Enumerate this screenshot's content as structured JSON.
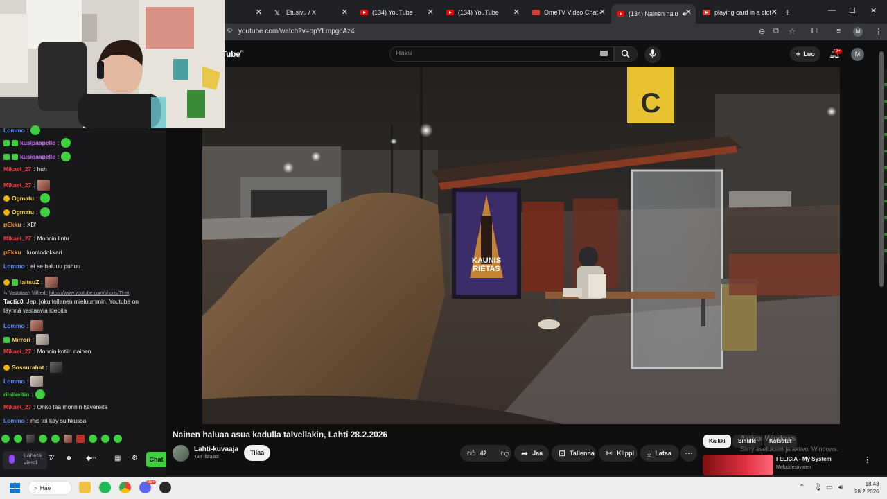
{
  "browser": {
    "tabs": [
      {
        "label": "",
        "icon": "blank"
      },
      {
        "label": "Etusivu / X",
        "icon": "x-logo-icon"
      },
      {
        "label": "(134) YouTube",
        "icon": "youtube-icon"
      },
      {
        "label": "(134) YouTube",
        "icon": "youtube-icon"
      },
      {
        "label": "OmeTV Video Chat -",
        "icon": "ometv-icon"
      },
      {
        "label": "(134) Nainen halu",
        "icon": "youtube-icon",
        "active": true,
        "audio": true
      },
      {
        "label": "playing card in a clot",
        "icon": "card-icon"
      }
    ],
    "url": "youtube.com/watch?v=bpYLmpgcAz4",
    "profile_initial": "M"
  },
  "youtube": {
    "logo_text": "Tube",
    "logo_sup": "FI",
    "search_placeholder": "Haku",
    "create_label": "Luo",
    "notification_count": "9+",
    "avatar_initial": "M",
    "video": {
      "title": "Nainen haluaa asua kadulla talvellakin, Lahti 28.2.2026",
      "channel": "Lahti-kuvaaja",
      "subscribers": "438 tilaajaa",
      "subscribe_label": "Tilaa",
      "likes": "42",
      "share_label": "Jaa",
      "save_label": "Tallenna",
      "clip_label": "Klippi",
      "download_label": "Lataa",
      "poster_lines": [
        "KAUNIS",
        "RIETAS"
      ],
      "stop_letter": "C"
    },
    "chips": [
      "Kaikki",
      "Sinulle",
      "Katsotut"
    ],
    "windows_activation": {
      "line1": "Aktivoi Windows",
      "line2": "Siirry asetuksiin ja aktivoi Windows."
    },
    "recommendation": {
      "title": "FELICIA - My System",
      "channel": "Melodifestivalen"
    }
  },
  "chat": {
    "messages": [
      {
        "user": "Lommo",
        "color": "#5b8cff",
        "text": "",
        "emote": "green"
      },
      {
        "user": "kusipaapelle",
        "color": "#d070ff",
        "text": "",
        "emote": "green",
        "badges": [
          "g",
          "g"
        ]
      },
      {
        "user": "kusipaapelle",
        "color": "#d070ff",
        "text": "",
        "emote": "green",
        "badges": [
          "g",
          "g"
        ]
      },
      {
        "user": "Mikael_27",
        "color": "#ff3b3b",
        "text": "huh"
      },
      {
        "user": "Mikael_27",
        "color": "#ff3b3b",
        "text": "",
        "emote": "pic"
      },
      {
        "user": "Ogmatu",
        "color": "#ffd84d",
        "text": "",
        "emote": "green",
        "badges": [
          "y"
        ]
      },
      {
        "user": "Ogmatu",
        "color": "#ffd84d",
        "text": "",
        "emote": "green",
        "badges": [
          "y"
        ]
      },
      {
        "user": "pEkku",
        "color": "#ff9a1f",
        "text": "XD'"
      },
      {
        "user": "Mikael_27",
        "color": "#ff3b3b",
        "text": "Monnin lintu"
      },
      {
        "user": "pEkku",
        "color": "#ff9a1f",
        "text": "luontodokkari"
      },
      {
        "user": "Lommo",
        "color": "#5b8cff",
        "text": "ei se haluuu puhuu"
      },
      {
        "user": "laitsuZ",
        "color": "#ffd84d",
        "text": "",
        "emote": "pic",
        "badges": [
          "y",
          "g"
        ]
      }
    ],
    "reply_prefix": "Vastataan Vilfredi:",
    "reply_link": "https://www.youtube.com/shorts/Tf-m",
    "long_message": {
      "user": "Tactic0",
      "color": "#ffffff",
      "line1": "Jep, joku tollanen mieluummin. Youtube on",
      "line2": "täynnä vastaavia ideoita"
    },
    "messages2": [
      {
        "user": "Lommo",
        "color": "#5b8cff",
        "text": "",
        "emote": "pic"
      },
      {
        "user": "Mirrori",
        "color": "#ffd84d",
        "text": "",
        "emote": "cat",
        "badges": [
          "g"
        ]
      },
      {
        "user": "Mikael_27",
        "color": "#ff3b3b",
        "text": "Monnin kotiin nainen"
      },
      {
        "user": "Sossurahat",
        "color": "#ffd84d",
        "text": "",
        "emote": "dark",
        "badges": [
          "y"
        ]
      },
      {
        "user": "Lommo",
        "color": "#5b8cff",
        "text": "",
        "emote": "cat"
      },
      {
        "user": "riisikeitin",
        "color": "#3fcf3f",
        "text": "",
        "emote": "green"
      },
      {
        "user": "Mikael_27",
        "color": "#ff3b3b",
        "text": "Onko tää monnin kavereita"
      },
      {
        "user": "Lommo",
        "color": "#5b8cff",
        "text": "mis toi käy suihkussa"
      }
    ],
    "send_placeholder_1": "Lähetä",
    "send_placeholder_2": "viesti",
    "chat_button": "Chat"
  },
  "taskbar": {
    "search_label": "Hae",
    "time": "18.43",
    "date": "28.2.2026",
    "discord_badge": "99+"
  }
}
